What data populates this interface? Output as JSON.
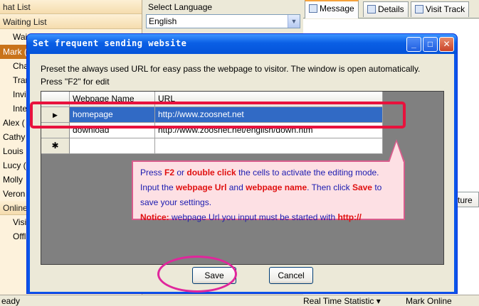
{
  "left_panel": {
    "items": [
      {
        "label": "hat List",
        "kind": "head"
      },
      {
        "label": "Waiting List",
        "kind": "head"
      },
      {
        "label": "Wai",
        "kind": "child"
      },
      {
        "label": "Mark (",
        "kind": "selected"
      },
      {
        "label": "Cha",
        "kind": "child"
      },
      {
        "label": "Tran",
        "kind": "child"
      },
      {
        "label": "Invi",
        "kind": "child"
      },
      {
        "label": "Inte",
        "kind": "child"
      },
      {
        "label": "Alex (",
        "kind": "item"
      },
      {
        "label": "Cathy",
        "kind": "item"
      },
      {
        "label": "Louis",
        "kind": "item"
      },
      {
        "label": "Lucy (",
        "kind": "item"
      },
      {
        "label": "Molly",
        "kind": "item"
      },
      {
        "label": "Veron",
        "kind": "item"
      },
      {
        "label": "Online",
        "kind": "head"
      },
      {
        "label": "Visit",
        "kind": "child"
      },
      {
        "label": "Offl",
        "kind": "child"
      }
    ]
  },
  "language": {
    "label": "Select Language",
    "value": "English"
  },
  "tabs": [
    {
      "label": "Message",
      "active": true
    },
    {
      "label": "Details",
      "active": false
    },
    {
      "label": "Visit Track",
      "active": false
    }
  ],
  "structure_tab": "cture",
  "statusbar": {
    "ready": "eady",
    "realtime": "Real Time Statistic",
    "user": "Mark Online"
  },
  "dialog": {
    "title": "Set frequent sending website",
    "instruction_line1": "Preset the always used URL for easy pass the webpage to visitor. The window is open automatically.",
    "instruction_line2": "Press \"F2\" for edit",
    "columns": [
      "Webpage Name",
      "URL"
    ],
    "rows": [
      {
        "marker": "▶",
        "name": "homepage",
        "url": "http://www.zoosnet.net",
        "selected": true
      },
      {
        "marker": "",
        "name": "download",
        "url": "http://www.zoosnet.net/english/down.htm",
        "selected": false
      },
      {
        "marker": "✱",
        "name": "",
        "url": "",
        "selected": false
      }
    ],
    "callout": {
      "t1": "Press ",
      "k1": "F2",
      "t2": " or ",
      "k2": "double click",
      "t3": " the cells to activate the editing mode. Input the ",
      "k3": "webpage Url",
      "t4": " and ",
      "k4": "webpage name",
      "t5": ". Then click ",
      "k5": "Save",
      "t6": " to save your settings.",
      "notice_label": "Notice:",
      "notice_text": " webpage Url you input must be started with ",
      "notice_kw": "http://"
    },
    "save_label": "Save",
    "cancel_label": "Cancel"
  },
  "colors": {
    "title_bar": "#0a5fe5",
    "selected_row": "#316ac5",
    "highlight_box": "#e8123d",
    "callout_bg": "#fde0e4",
    "ellipse": "#e0269c"
  }
}
